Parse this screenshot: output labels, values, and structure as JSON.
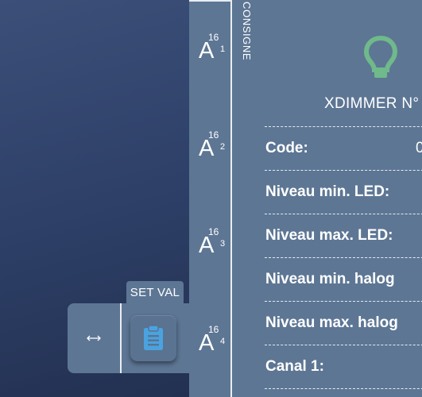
{
  "setval": {
    "tab_label": "SET VAL"
  },
  "icons": {
    "move_handle": "horizontal-arrows-icon",
    "clipboard": "clipboard-icon",
    "bulb": "lightbulb-icon",
    "bulb_color": "#6fb98a",
    "clipboard_color": "#4aa3e0"
  },
  "column_label": "CONSIGNE",
  "channels": [
    {
      "letter": "A",
      "sup": "16",
      "sub": "1"
    },
    {
      "letter": "A",
      "sup": "16",
      "sub": "2"
    },
    {
      "letter": "A",
      "sup": "16",
      "sub": "3"
    },
    {
      "letter": "A",
      "sup": "16",
      "sub": "4"
    }
  ],
  "device": {
    "title": "XDIMMER N°",
    "rows": [
      {
        "label": "Code:",
        "value": "0"
      },
      {
        "label": "Niveau min. LED:",
        "value": ""
      },
      {
        "label": "Niveau max. LED:",
        "value": ""
      },
      {
        "label": "Niveau min. halog",
        "value": ""
      },
      {
        "label": "Niveau max. halog",
        "value": ""
      },
      {
        "label": "Canal 1:",
        "value": ""
      }
    ]
  }
}
